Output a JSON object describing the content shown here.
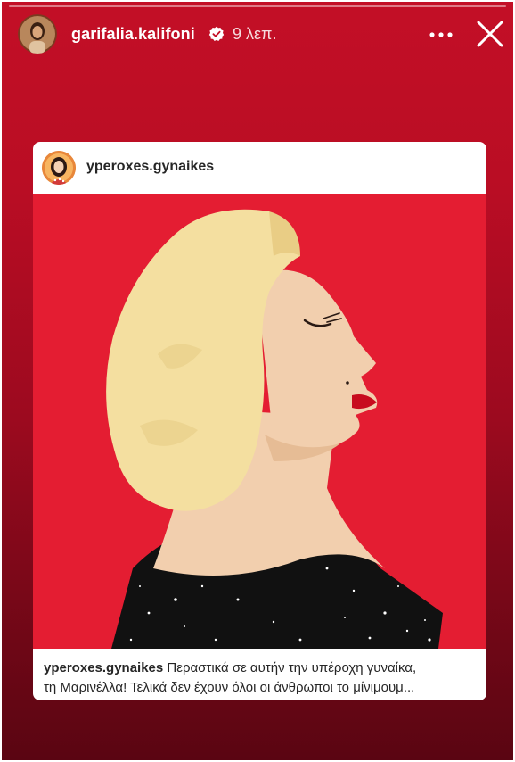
{
  "story": {
    "username": "garifalia.kalifoni",
    "time": "9 λεπ.",
    "icons": {
      "verified": "verified-badge-icon",
      "more": "more-icon",
      "close": "close-icon"
    }
  },
  "shared_post": {
    "username": "yperoxes.gynaikes",
    "caption_user": "yperoxes.gynaikes",
    "caption_line1": "Περαστικά σε αυτήν την υπέροχη γυναίκα,",
    "caption_line2": "τη Μαρινέλλα! Τελικά δεν έχουν όλοι οι άνθρωποι το μίνιμουμ..."
  },
  "colors": {
    "story_background": "#c30f26",
    "illustration_background": "#e41d32",
    "hair": "#f4dfa0",
    "skin": "#f2cfae",
    "dress": "#111111",
    "lips": "#c80c1e"
  }
}
